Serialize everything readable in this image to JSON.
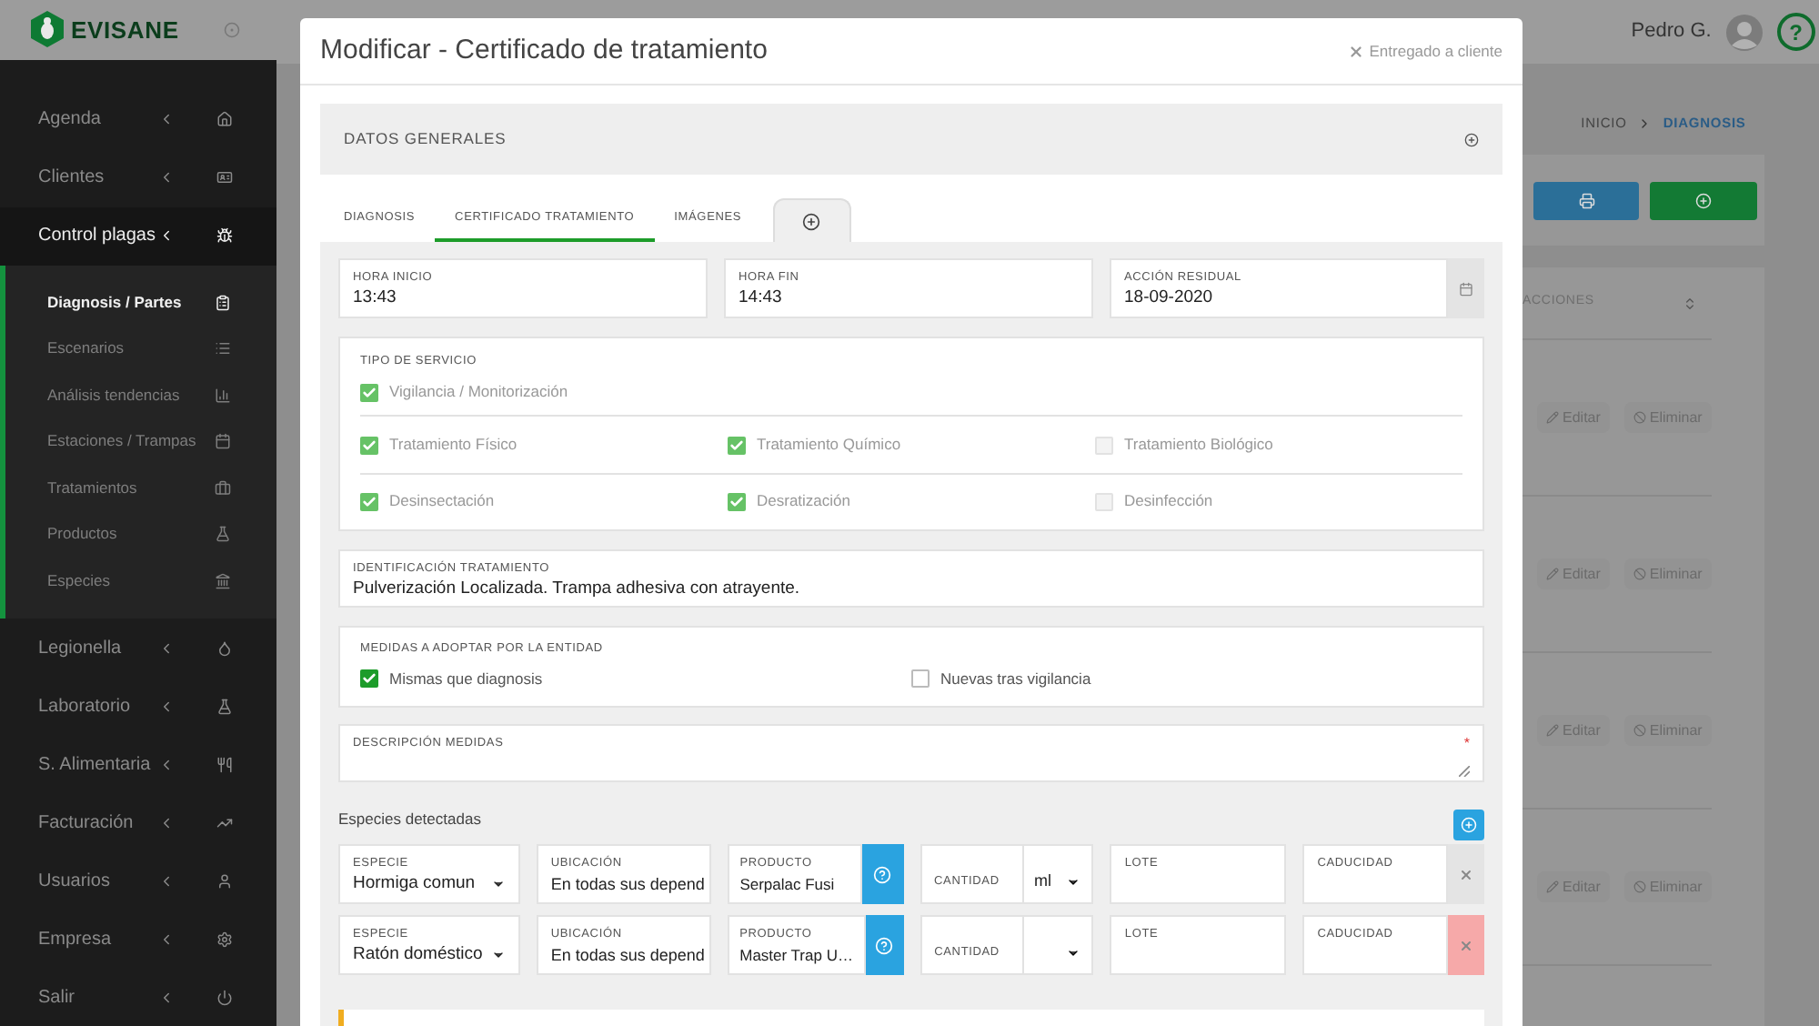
{
  "sidebar": {
    "brand": "EVISANE",
    "items": [
      {
        "label": "Agenda",
        "selected": false
      },
      {
        "label": "Clientes",
        "selected": false
      },
      {
        "label": "Control plagas",
        "selected": true,
        "children": [
          {
            "label": "Diagnosis / Partes",
            "selected": true
          },
          {
            "label": "Escenarios",
            "selected": false
          },
          {
            "label": "Análisis tendencias",
            "selected": false
          },
          {
            "label": "Estaciones / Trampas",
            "selected": false
          },
          {
            "label": "Tratamientos",
            "selected": false
          },
          {
            "label": "Productos",
            "selected": false
          },
          {
            "label": "Especies",
            "selected": false
          }
        ]
      },
      {
        "label": "Legionella",
        "selected": false
      },
      {
        "label": "Laboratorio",
        "selected": false
      },
      {
        "label": "S. Alimentaria",
        "selected": false
      },
      {
        "label": "Facturación",
        "selected": false
      },
      {
        "label": "Usuarios",
        "selected": false
      },
      {
        "label": "Empresa",
        "selected": false
      },
      {
        "label": "Salir",
        "selected": false
      }
    ]
  },
  "top_bar": {
    "user": "Pedro G.",
    "help_button": "?"
  },
  "breadcrumb": [
    {
      "label": "INICIO",
      "selected": false
    },
    {
      "label": "DIAGNOSIS",
      "selected": true
    }
  ],
  "table": {
    "columns": [
      "ACCIONES"
    ],
    "rows": [
      {
        "actions": [
          "Editar",
          "Eliminar"
        ]
      },
      {
        "actions": [
          "Editar",
          "Eliminar"
        ]
      },
      {
        "actions": [
          "Editar",
          "Eliminar"
        ]
      },
      {
        "actions": [
          "Editar",
          "Eliminar"
        ]
      }
    ]
  },
  "modal": {
    "title": "Modificar - Certificado de tratamiento",
    "status": {
      "label": "Entregado a cliente",
      "on": false
    },
    "section": "DATOS GENERALES",
    "tabs": [
      {
        "label": "DIAGNOSIS",
        "selected": false
      },
      {
        "label": "CERTIFICADO TRATAMIENTO",
        "selected": true
      },
      {
        "label": "IMÁGENES",
        "selected": false
      }
    ],
    "times": [
      {
        "label": "HORA INICIO",
        "value": "13:43"
      },
      {
        "label": "HORA FIN",
        "value": "14:43"
      },
      {
        "label": "ACCIÓN RESIDUAL",
        "value": "18-09-2020",
        "kind": "date"
      }
    ],
    "service_type": {
      "label": "TIPO DE SERVICIO",
      "disabled": true,
      "rows": [
        [
          {
            "label": "Vigilancia / Monitorización",
            "checked": true
          }
        ],
        [
          {
            "label": "Tratamiento Físico",
            "checked": true
          },
          {
            "label": "Tratamiento Químico",
            "checked": true
          },
          {
            "label": "Tratamiento Biológico",
            "checked": false
          }
        ],
        [
          {
            "label": "Desinsectación",
            "checked": true
          },
          {
            "label": "Desratización",
            "checked": true
          },
          {
            "label": "Desinfección",
            "checked": false
          }
        ]
      ]
    },
    "identification": {
      "label": "IDENTIFICACIÓN TRATAMIENTO",
      "value": "Pulverización Localizada. Trampa adhesiva con atrayente."
    },
    "measures": {
      "label": "MEDIDAS A ADOPTAR POR LA ENTIDAD",
      "disabled": false,
      "options": [
        {
          "label": "Mismas que diagnosis",
          "checked": true
        },
        {
          "label": "Nuevas tras vigilancia",
          "checked": false
        }
      ]
    },
    "description": {
      "label": "DESCRIPCIÓN MEDIDAS",
      "required_mark": "*"
    },
    "species": {
      "label": "Especies detectadas",
      "rows": [
        {
          "species": {
            "label": "ESPECIE",
            "value": "Hormiga comun"
          },
          "location": {
            "label": "UBICACIÓN",
            "value": "En todas sus depend"
          },
          "product": {
            "label": "PRODUCTO",
            "value": "Serpalac Fusi"
          },
          "quantity": {
            "label": "CANTIDAD",
            "unit": "ml"
          },
          "batch": {
            "label": "LOTE"
          },
          "expiry": {
            "label": "CADUCIDAD"
          },
          "remove_disabled": true
        },
        {
          "species": {
            "label": "ESPECIE",
            "value": "Ratón doméstico"
          },
          "location": {
            "label": "UBICACIÓN",
            "value": "En todas sus depend"
          },
          "product": {
            "label": "PRODUCTO",
            "value": "Master Trap U…"
          },
          "quantity": {
            "label": "CANTIDAD"
          },
          "batch": {
            "label": "LOTE"
          },
          "expiry": {
            "label": "CADUCIDAD"
          },
          "remove_disabled": false
        }
      ]
    }
  }
}
